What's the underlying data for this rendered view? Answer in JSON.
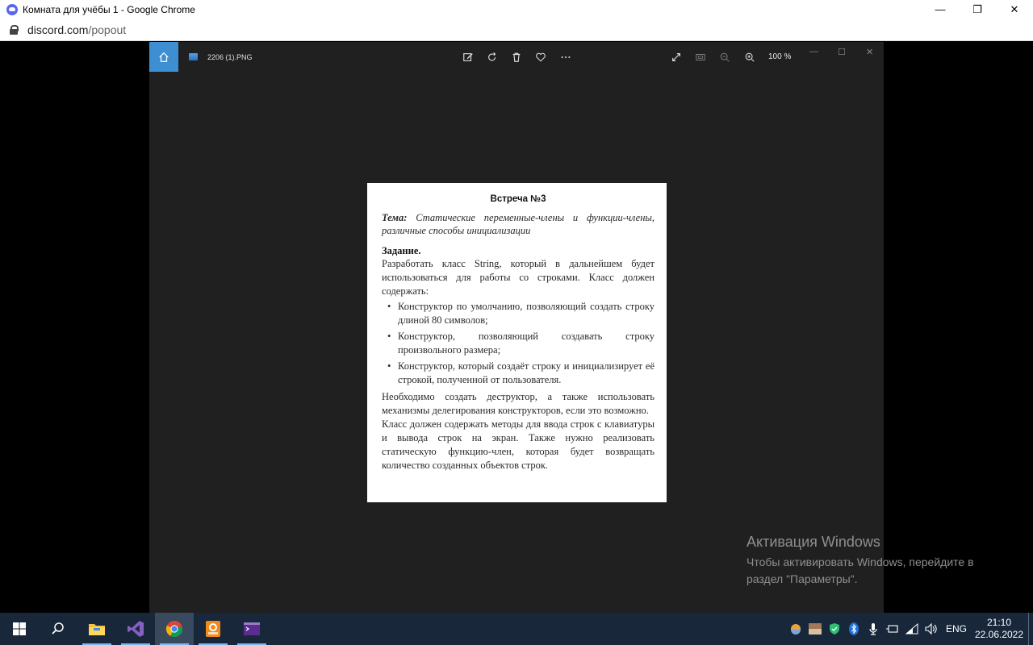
{
  "window": {
    "title": "Комната для учёбы 1 - Google Chrome",
    "controls": {
      "minimize": "—",
      "restore": "❐",
      "close": "✕"
    }
  },
  "address": {
    "domain": "discord.com",
    "path": "/popout"
  },
  "viewer": {
    "file_name": "2206 (1).PNG",
    "zoom": "100 %",
    "icons": [
      "home-icon",
      "edit-icon",
      "rotate-icon",
      "delete-icon",
      "favorite-icon",
      "more-icon",
      "fullscreen-icon",
      "fit-icon",
      "zoom-out-icon",
      "zoom-in-icon"
    ]
  },
  "document": {
    "heading": "Встреча №3",
    "topic_label": "Тема:",
    "topic_text": "Статические переменные-члены и функции-члены, различные способы инициализации",
    "task_heading": "Задание.",
    "intro": "Разработать класс String, который в дальнейшем будет использоваться для работы со строками. Класс должен содержать:",
    "items": [
      "Конструктор по умолчанию, позволяющий создать строку длиной 80 символов;",
      "Конструктор, позволяющий создавать строку произвольного размера;",
      "Конструктор, который создаёт строку и инициализирует её строкой, полученной от пользователя."
    ],
    "para1": "Необходимо создать деструктор, а также использовать механизмы делегирования конструкторов, если это возможно.",
    "para2": "Класс должен содержать методы для ввода строк с клавиатуры и вывода строк на экран. Также нужно реализовать статическую функцию-член, которая будет возвращать количество созданных объектов строк."
  },
  "activation": {
    "title": "Активация Windows",
    "line1": "Чтобы активировать Windows, перейдите в",
    "line2": "раздел \"Параметры\"."
  },
  "taskbar": {
    "apps": [
      "start-icon",
      "search-icon",
      "file-explorer-icon",
      "visual-studio-icon",
      "chrome-icon",
      "pdf-editor-icon",
      "terminal-icon"
    ],
    "language": "ENG",
    "time": "21:10",
    "date": "22.06.2022"
  },
  "colors": {
    "viewer_bg": "#202020",
    "home_accent": "#3e8fd2",
    "taskbar_bg": "#18273a"
  }
}
